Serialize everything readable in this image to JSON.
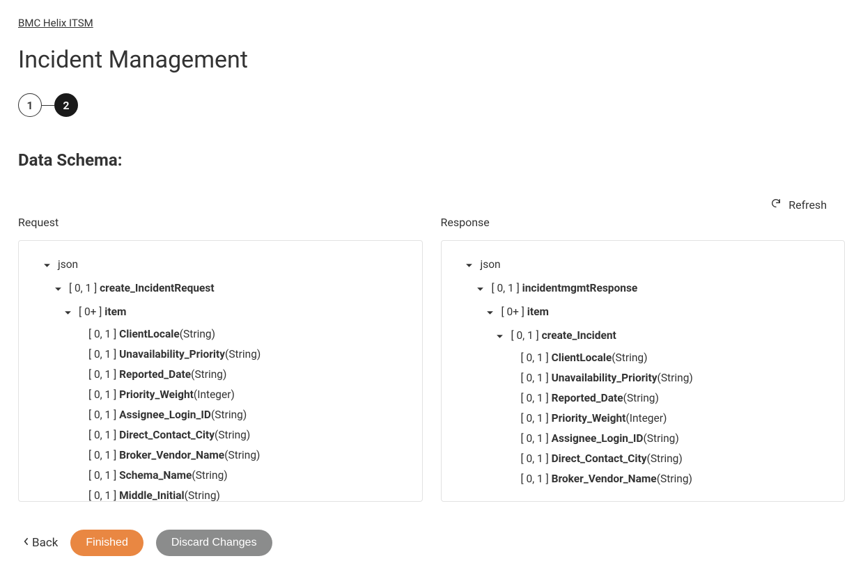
{
  "breadcrumb": "BMC Helix ITSM",
  "title": "Incident Management",
  "stepper": {
    "step1": "1",
    "step2": "2"
  },
  "section_title": "Data Schema:",
  "refresh_label": "Refresh",
  "request": {
    "header": "Request",
    "root": "json",
    "group_card": "[ 0, 1 ]",
    "group_name": "create_IncidentRequest",
    "item_card": "[ 0+ ]",
    "item_name": "item",
    "fields": [
      {
        "card": "[ 0, 1 ]",
        "name": "ClientLocale",
        "type": "(String)"
      },
      {
        "card": "[ 0, 1 ]",
        "name": "Unavailability_Priority",
        "type": "(String)"
      },
      {
        "card": "[ 0, 1 ]",
        "name": "Reported_Date",
        "type": "(String)"
      },
      {
        "card": "[ 0, 1 ]",
        "name": "Priority_Weight",
        "type": "(Integer)"
      },
      {
        "card": "[ 0, 1 ]",
        "name": "Assignee_Login_ID",
        "type": "(String)"
      },
      {
        "card": "[ 0, 1 ]",
        "name": "Direct_Contact_City",
        "type": "(String)"
      },
      {
        "card": "[ 0, 1 ]",
        "name": "Broker_Vendor_Name",
        "type": "(String)"
      },
      {
        "card": "[ 0, 1 ]",
        "name": "Schema_Name",
        "type": "(String)"
      },
      {
        "card": "[ 0, 1 ]",
        "name": "Middle_Initial",
        "type": "(String)"
      }
    ]
  },
  "response": {
    "header": "Response",
    "root": "json",
    "group_card": "[ 0, 1 ]",
    "group_name": "incidentmgmtResponse",
    "item_card": "[ 0+ ]",
    "item_name": "item",
    "sub_card": "[ 0, 1 ]",
    "sub_name": "create_Incident",
    "fields": [
      {
        "card": "[ 0, 1 ]",
        "name": "ClientLocale",
        "type": "(String)"
      },
      {
        "card": "[ 0, 1 ]",
        "name": "Unavailability_Priority",
        "type": "(String)"
      },
      {
        "card": "[ 0, 1 ]",
        "name": "Reported_Date",
        "type": "(String)"
      },
      {
        "card": "[ 0, 1 ]",
        "name": "Priority_Weight",
        "type": "(Integer)"
      },
      {
        "card": "[ 0, 1 ]",
        "name": "Assignee_Login_ID",
        "type": "(String)"
      },
      {
        "card": "[ 0, 1 ]",
        "name": "Direct_Contact_City",
        "type": "(String)"
      },
      {
        "card": "[ 0, 1 ]",
        "name": "Broker_Vendor_Name",
        "type": "(String)"
      }
    ]
  },
  "footer": {
    "back": "Back",
    "finished": "Finished",
    "discard": "Discard Changes"
  }
}
